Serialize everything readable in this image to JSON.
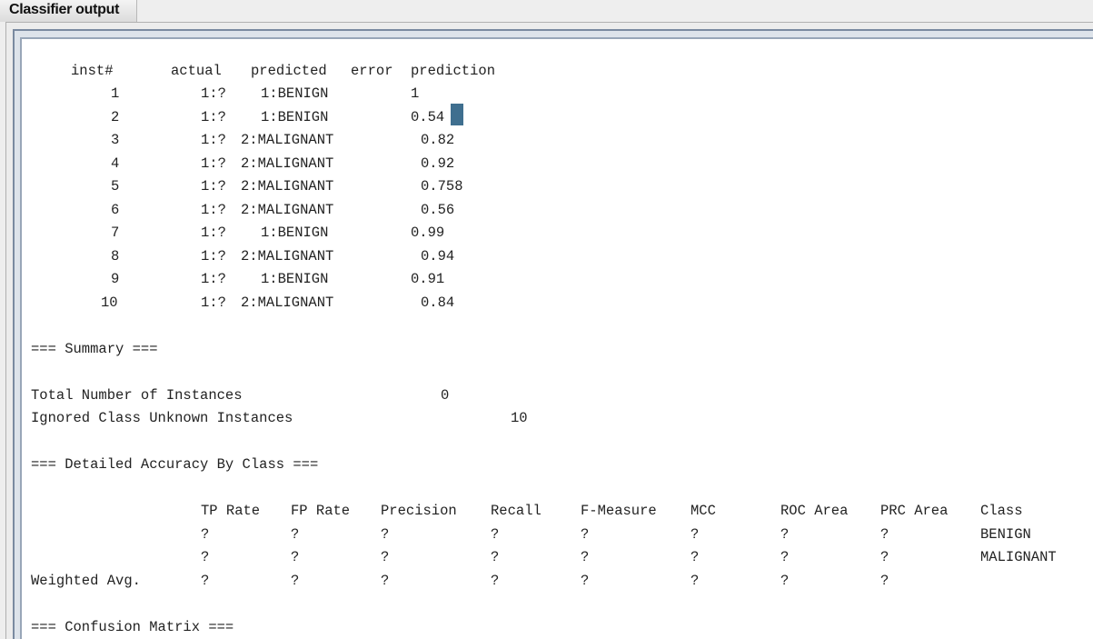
{
  "window": {
    "title": "Classifier output"
  },
  "predictions": {
    "headers": {
      "inst": "inst#",
      "actual": "actual",
      "predicted": "predicted",
      "error": "error",
      "prediction": "prediction"
    },
    "rows": [
      {
        "inst": "1",
        "actual": "1:?",
        "predicted": "1:BENIGN",
        "prediction": "1"
      },
      {
        "inst": "2",
        "actual": "1:?",
        "predicted": "1:BENIGN",
        "prediction": "0.54"
      },
      {
        "inst": "3",
        "actual": "1:?",
        "predicted": "2:MALIGNANT",
        "prediction": "0.82"
      },
      {
        "inst": "4",
        "actual": "1:?",
        "predicted": "2:MALIGNANT",
        "prediction": "0.92"
      },
      {
        "inst": "5",
        "actual": "1:?",
        "predicted": "2:MALIGNANT",
        "prediction": "0.758"
      },
      {
        "inst": "6",
        "actual": "1:?",
        "predicted": "2:MALIGNANT",
        "prediction": "0.56"
      },
      {
        "inst": "7",
        "actual": "1:?",
        "predicted": "1:BENIGN",
        "prediction": "0.99"
      },
      {
        "inst": "8",
        "actual": "1:?",
        "predicted": "2:MALIGNANT",
        "prediction": "0.94"
      },
      {
        "inst": "9",
        "actual": "1:?",
        "predicted": "1:BENIGN",
        "prediction": "0.91"
      },
      {
        "inst": "10",
        "actual": "1:?",
        "predicted": "2:MALIGNANT",
        "prediction": "0.84"
      }
    ]
  },
  "summary": {
    "heading": "=== Summary ===",
    "total_label": "Total Number of Instances",
    "total_value": "0",
    "ignored_label": "Ignored Class Unknown Instances",
    "ignored_value": "10"
  },
  "accuracy": {
    "heading": "=== Detailed Accuracy By Class ===",
    "columns": [
      "TP Rate",
      "FP Rate",
      "Precision",
      "Recall",
      "F-Measure",
      "MCC",
      "ROC Area",
      "PRC Area",
      "Class"
    ],
    "rows": [
      {
        "label": "",
        "values": [
          "?",
          "?",
          "?",
          "?",
          "?",
          "?",
          "?",
          "?"
        ],
        "class": "BENIGN"
      },
      {
        "label": "",
        "values": [
          "?",
          "?",
          "?",
          "?",
          "?",
          "?",
          "?",
          "?"
        ],
        "class": "MALIGNANT"
      },
      {
        "label": "Weighted Avg.",
        "values": [
          "?",
          "?",
          "?",
          "?",
          "?",
          "?",
          "?",
          "?"
        ],
        "class": ""
      }
    ]
  },
  "confusion": {
    "heading": "=== Confusion Matrix ==="
  }
}
